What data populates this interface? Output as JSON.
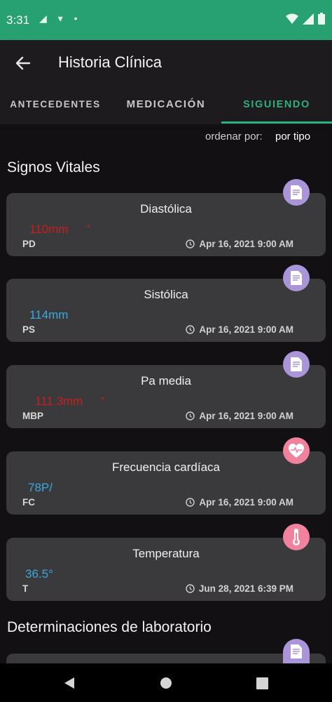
{
  "status_bar": {
    "time": "3:31",
    "left_icons": "◢ ▾ •"
  },
  "app_bar": {
    "title": "Historia Clínica"
  },
  "tabs": [
    {
      "label": "ANTECEDENTES"
    },
    {
      "label": "MEDICACIÓN"
    },
    {
      "label": "SIGUIENDO"
    }
  ],
  "sort": {
    "label": "ordenar por:",
    "value": "por tipo"
  },
  "sections": {
    "vitals_title": "Signos Vitales",
    "lab_title": "Determinaciones de laboratorio"
  },
  "cards": [
    {
      "title": "Diastólica",
      "value": "110mm",
      "code": "PD",
      "date": "Apr 16, 2021 9:00 AM",
      "alert": true,
      "icon": "document-icon"
    },
    {
      "title": "Sistólica",
      "value": "114mm",
      "code": "PS",
      "date": "Apr 16, 2021 9:00 AM",
      "alert": false,
      "icon": "document-icon"
    },
    {
      "title": "Pa media",
      "value": "111.3mm",
      "code": "MBP",
      "date": "Apr 16, 2021 9:00 AM",
      "alert": true,
      "icon": "document-icon"
    },
    {
      "title": "Frecuencia cardíaca",
      "value": "78P/",
      "code": "FC",
      "date": "Apr 16, 2021 9:00 AM",
      "alert": false,
      "icon": "heart-pulse-icon"
    },
    {
      "title": "Temperatura",
      "value": "36.5°",
      "code": "T",
      "date": "Jun 28, 2021 6:39 PM",
      "alert": false,
      "icon": "thermometer-icon"
    }
  ],
  "alert_mark": "*",
  "colors": {
    "accent": "#2bb07e",
    "status_bar": "#27a072",
    "alert": "#c81e1e",
    "normal_value": "#3aa8e0",
    "badge_doc": "#a995d8",
    "badge_health": "#f0829e"
  }
}
